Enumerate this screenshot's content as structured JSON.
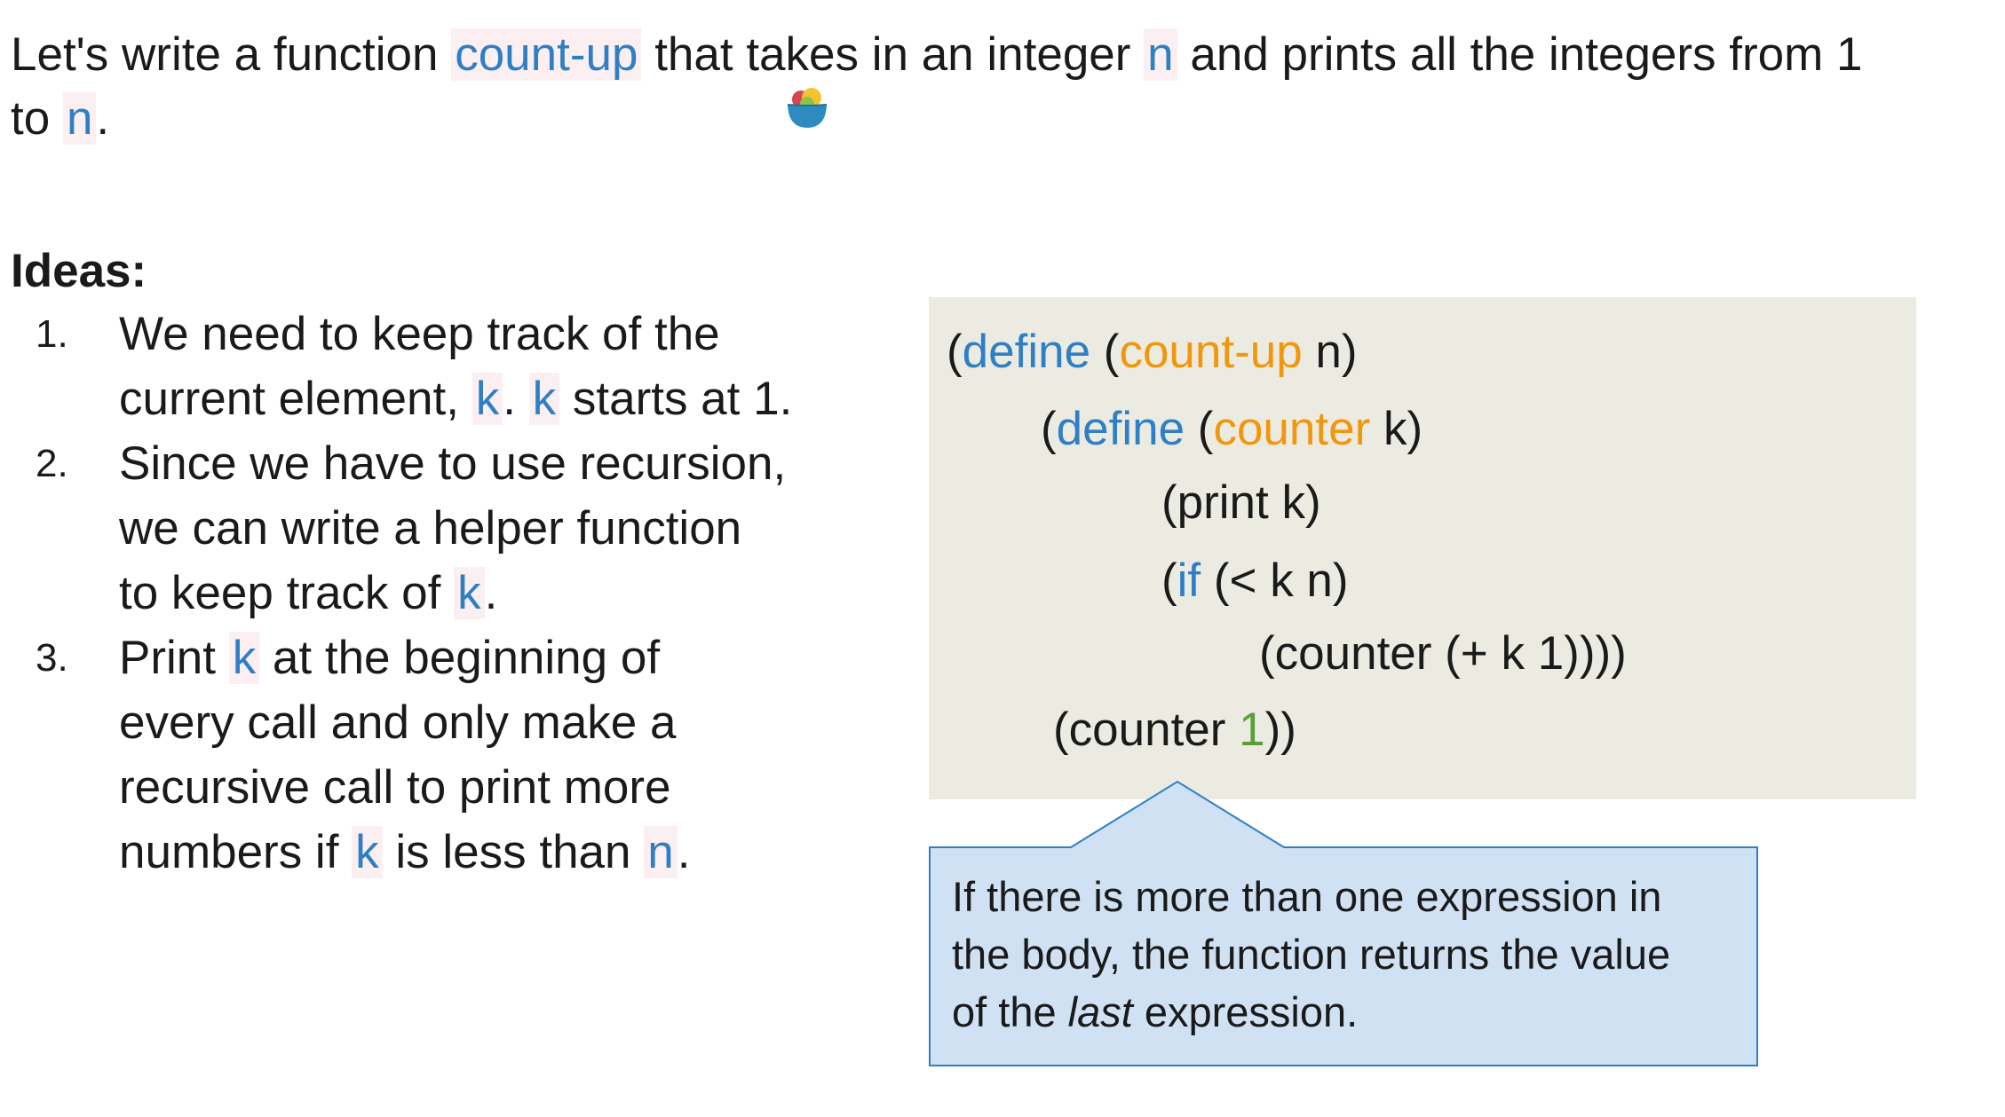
{
  "intro": {
    "t1": "Let's write a function ",
    "fn": "count-up",
    "t2": " that takes in an integer ",
    "n1": "n",
    "t3": " and prints all the integers from 1",
    "t4": "to ",
    "n2": "n",
    "t5": "."
  },
  "ideas": {
    "heading": "Ideas:",
    "items": [
      {
        "num": "1.",
        "line1": "We need to keep track of the",
        "line2a": "current element, ",
        "k1": "k",
        "line2b": ". ",
        "k2": "k",
        "line2c": " starts at 1."
      },
      {
        "num": "2.",
        "line1": "Since we have to use recursion,",
        "line2": "we can write a helper function",
        "line3a": "to keep track of ",
        "k": "k",
        "line3b": "."
      },
      {
        "num": "3.",
        "line1a": "Print ",
        "k1": "k",
        "line1b": " at the beginning of",
        "line2": "every call and only make a",
        "line3": "recursive call to print more",
        "line4a": "numbers if ",
        "k2": "k",
        "line4b": " is less than ",
        "n": "n",
        "line4c": "."
      }
    ]
  },
  "code": {
    "l1": {
      "p1": "(",
      "kw": "define",
      "p2": " (",
      "fn": "count-up",
      "p3": " n)"
    },
    "l2": {
      "p1": "(",
      "kw": "define",
      "p2": " (",
      "fn": "counter",
      "p3": " k)"
    },
    "l3": "(print k)",
    "l4": {
      "p1": "(",
      "kw": "if",
      "p2": " (< k n)"
    },
    "l5": "(counter (+ k 1))))",
    "l6": {
      "p1": "(counter ",
      "num": "1",
      "p2": "))"
    }
  },
  "callout": {
    "a": "If there is more than one expression in",
    "b": "the body, the function returns the value",
    "c1": "of the ",
    "c_em": "last",
    "c2": " expression."
  },
  "colors": {
    "keyword": "#2f7fc6",
    "function_name": "#f2960c",
    "number": "#5b9f3a",
    "code_background": "#ecebe1",
    "callout_fill": "#cfe1f3",
    "callout_border": "#2f7fc6",
    "highlight_background": "#fbeff2"
  },
  "icons": {
    "emoji": "food-bowl-icon"
  }
}
